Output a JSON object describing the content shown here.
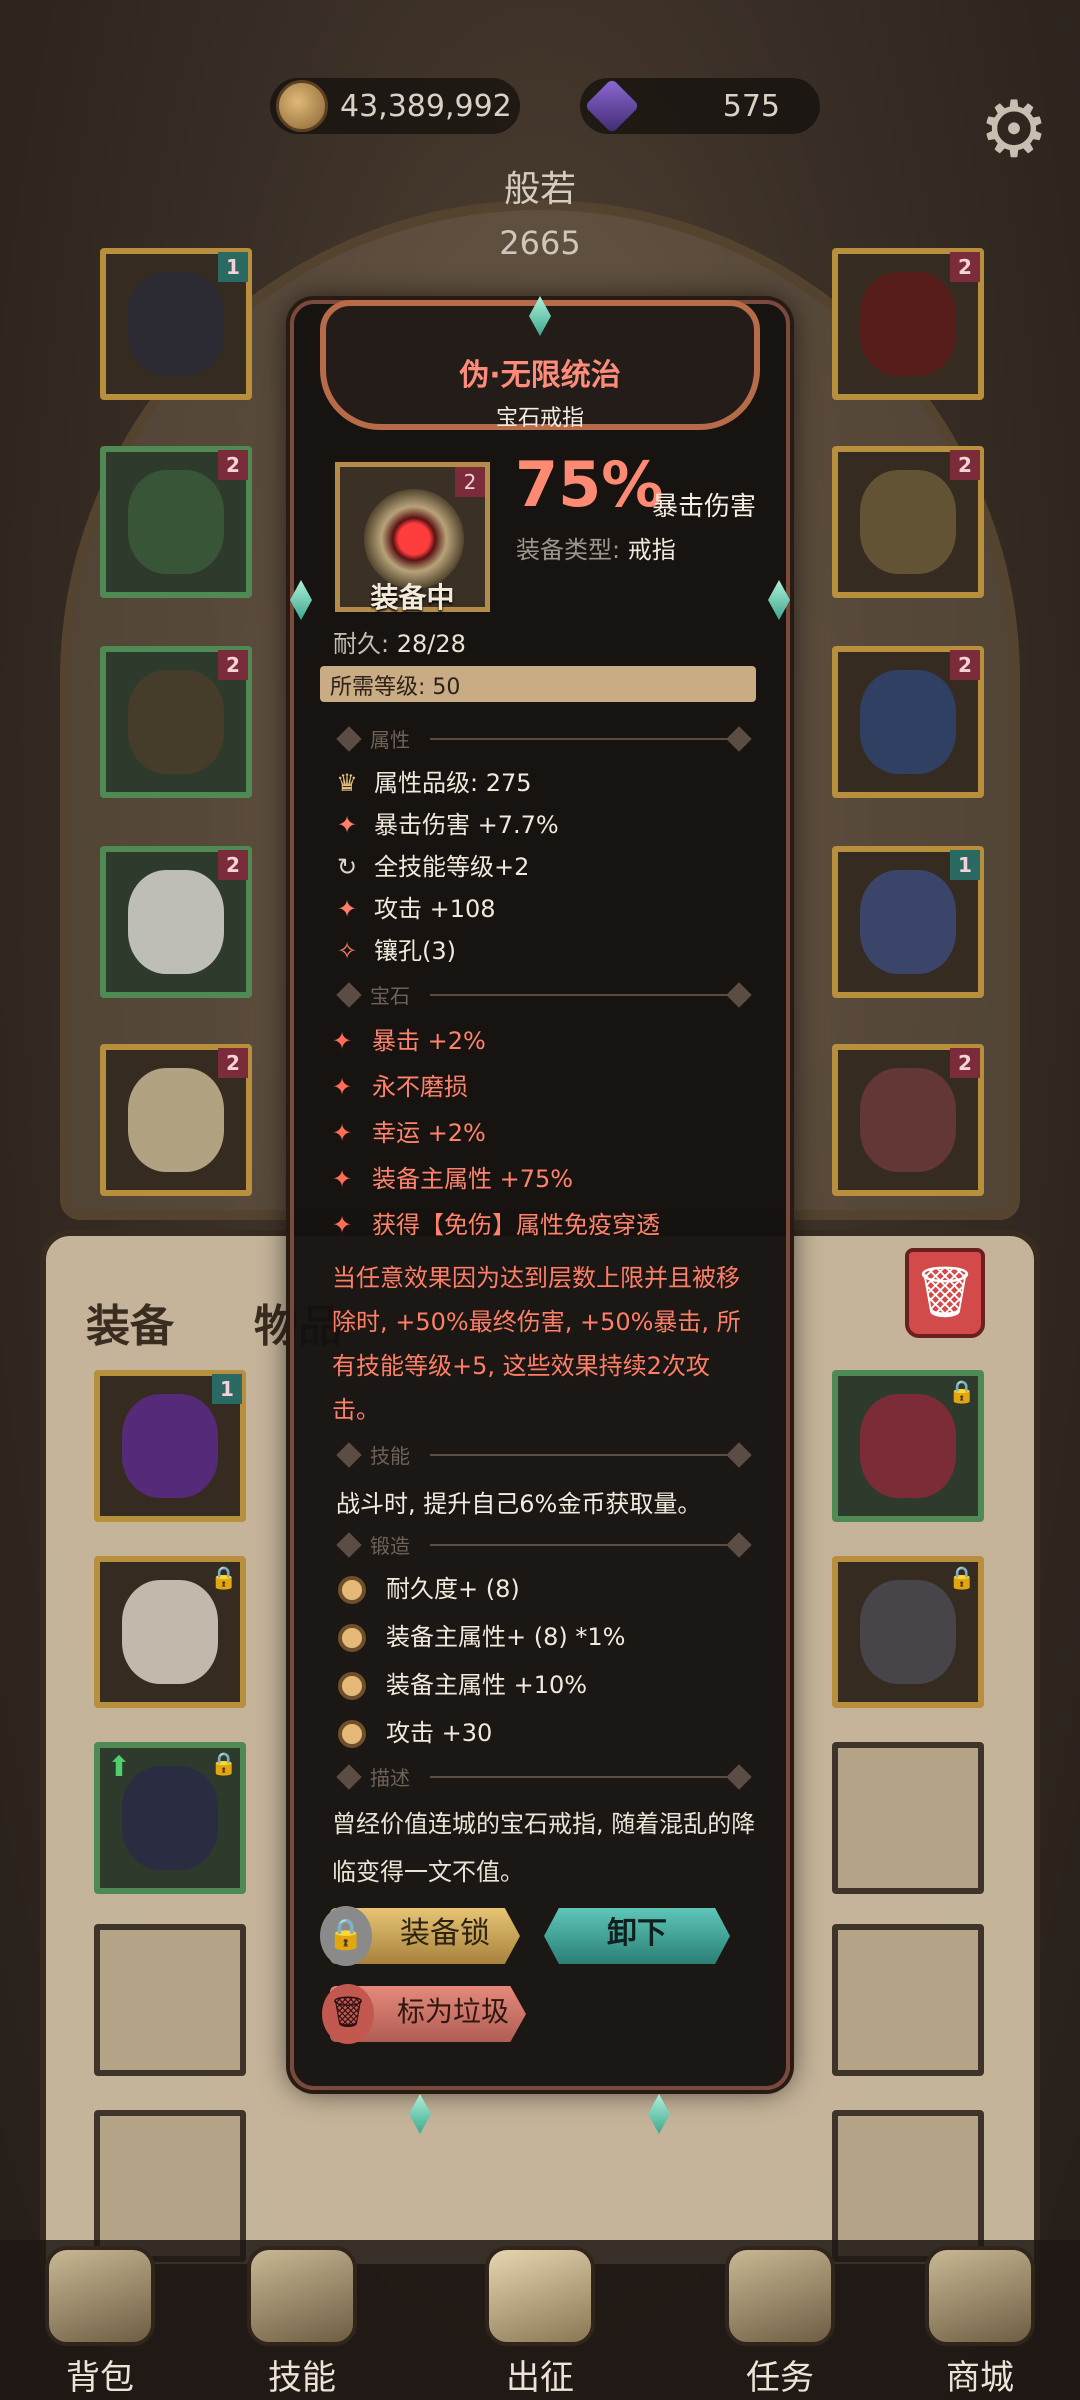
{
  "currencies": {
    "gold": "43,389,992",
    "gems": "575"
  },
  "hero": {
    "name": "般若",
    "power": "2665"
  },
  "item": {
    "name": "伪·无限统治",
    "subtype": "宝石戒指",
    "level_tag": "2",
    "status": "装备中",
    "crit_percent": "75%",
    "crit_label": "暴击伤害",
    "type_key": "装备类型:",
    "type_value": "戒指",
    "durability_key": "耐久:",
    "durability_value": "28/28",
    "required_level": "所需等级: 50"
  },
  "sections": {
    "attributes": "属性",
    "gems": "宝石",
    "skills": "技能",
    "forge": "锻造",
    "description": "描述"
  },
  "attributes": [
    {
      "icon": "grade-icon",
      "text": "属性品级: 275"
    },
    {
      "icon": "crit-icon",
      "text": "暴击伤害 +7.7%"
    },
    {
      "icon": "refresh-icon",
      "text": "全技能等级+2"
    },
    {
      "icon": "attack-icon",
      "text": "攻击 +108"
    },
    {
      "icon": "socket-icon",
      "text": "镶孔(3)"
    }
  ],
  "gem_lines": [
    "暴击 +2%",
    "永不磨损",
    "幸运 +2%",
    "装备主属性 +75%",
    "获得【免伤】属性免疫穿透"
  ],
  "gem_effect": "当任意效果因为达到层数上限并且被移除时, +50%最终伤害, +50%暴击, 所有技能等级+5, 这些效果持续2次攻击。",
  "skill_text": "战斗时, 提升自己6%金币获取量。",
  "forge_lines": [
    "耐久度+ (8)",
    "装备主属性+ (8) *1%",
    "装备主属性 +10%",
    "攻击 +30"
  ],
  "description_text": "曾经价值连城的宝石戒指, 随着混乱的降临变得一文不值。",
  "buttons": {
    "lock": "装备锁",
    "unequip": "卸下",
    "junk": "标为垃圾"
  },
  "bag_tabs": {
    "equipment": "装备",
    "items": "物品"
  },
  "nav": [
    "背包",
    "技能",
    "出征",
    "任务",
    "商城"
  ],
  "colors": {
    "accent": "#ff8a73",
    "teal": "#4fb3a6",
    "gold": "#c9ab84"
  }
}
